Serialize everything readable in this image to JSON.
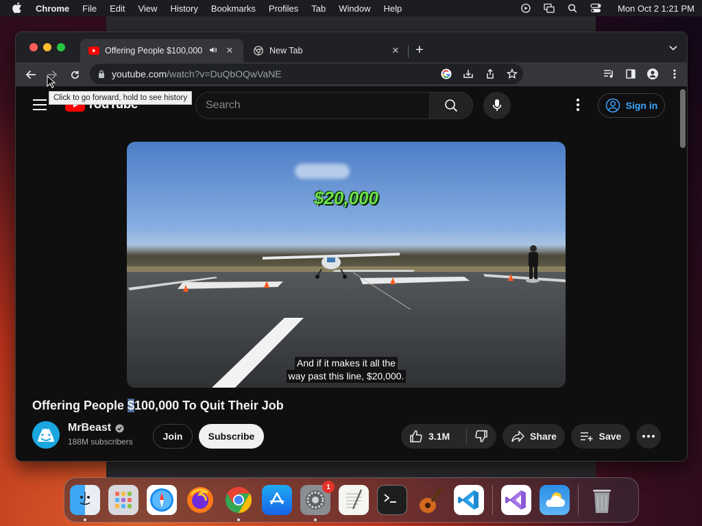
{
  "menubar": {
    "app": "Chrome",
    "items": [
      "File",
      "Edit",
      "View",
      "History",
      "Bookmarks",
      "Profiles",
      "Tab",
      "Window",
      "Help"
    ],
    "clock": "Mon Oct 2  1:21 PM"
  },
  "browser": {
    "tabs": [
      {
        "title": "Offering People $100,000",
        "active": true
      },
      {
        "title": "New Tab",
        "active": false
      }
    ],
    "url_host": "youtube.com",
    "url_path": "/watch?v=DuQbOQwVaNE",
    "tooltip": "Click to go forward, hold to see history"
  },
  "youtube": {
    "logo_text": "YouTube",
    "search_placeholder": "Search",
    "signin_label": "Sign in",
    "video": {
      "overlay_amount": "$20,000",
      "caption_line1": "And if it makes it all the",
      "caption_line2": "way past this line, $20,000."
    },
    "title_pre": "Offering People ",
    "title_sel": "$",
    "title_post": "100,000 To Quit Their Job",
    "channel": {
      "name": "MrBeast",
      "subscribers": "188M subscribers"
    },
    "join_label": "Join",
    "subscribe_label": "Subscribe",
    "like_count": "3.1M",
    "share_label": "Share",
    "save_label": "Save"
  },
  "dock": {
    "apps": [
      "Finder",
      "Launchpad",
      "Safari",
      "Firefox",
      "Chrome",
      "App Store",
      "System Settings",
      "TextEdit",
      "Terminal",
      "GarageBand",
      "Visual Studio Code",
      "Visual Studio",
      "Weather",
      "Trash"
    ],
    "settings_badge": "1"
  },
  "colors": {
    "yt_red": "#ff0000",
    "signin_blue": "#3ea6ff",
    "overlay_green": "#6ee04a"
  }
}
